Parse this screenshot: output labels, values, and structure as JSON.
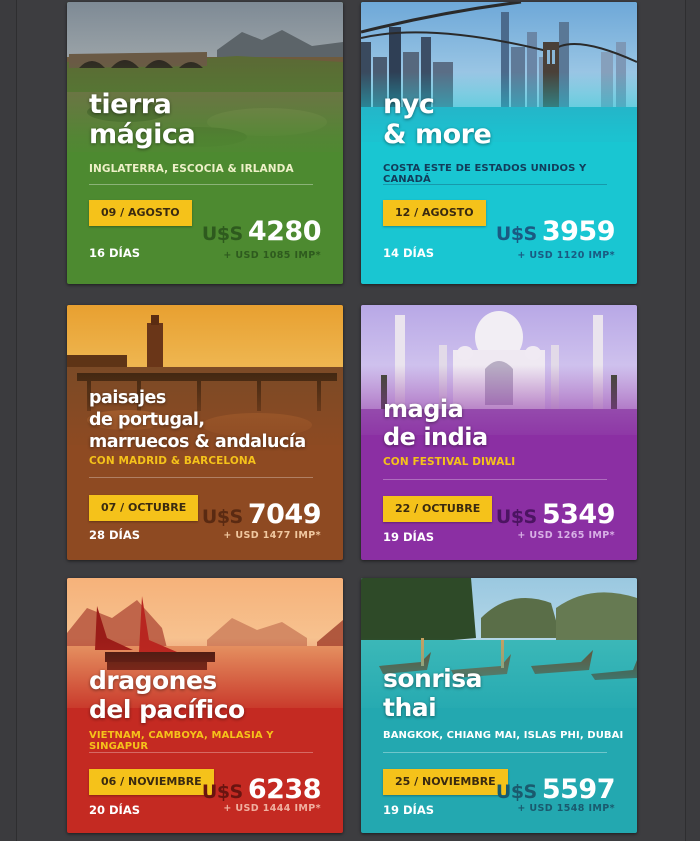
{
  "cards": [
    {
      "title_line1": "tierra",
      "title_line2": "mágica",
      "title_line3": "",
      "subtitle": "INGLATERRA, ESCOCIA & IRLANDA",
      "date": "09 / AGOSTO",
      "days": "16 DÍAS",
      "currency": "U$S",
      "price": "4280",
      "taxes": "+ USD 1085 IMP*",
      "color": "#4d8a30"
    },
    {
      "title_line1": "nyc",
      "title_line2": "& more",
      "title_line3": "",
      "subtitle": "COSTA ESTE DE ESTADOS UNIDOS Y CANADÁ",
      "date": "12 / AGOSTO",
      "days": "14 DÍAS",
      "currency": "U$S",
      "price": "3959",
      "taxes": "+ USD 1120 IMP*",
      "color": "#19c6d2"
    },
    {
      "title_line1": "paisajes",
      "title_line2": "de portugal,",
      "title_line3": "marruecos & andalucía",
      "subtitle": "CON MADRID & BARCELONA",
      "date": "07 / OCTUBRE",
      "days": "28 DÍAS",
      "currency": "U$S",
      "price": "7049",
      "taxes": "+ USD 1477 IMP*",
      "color": "#8e4a22"
    },
    {
      "title_line1": "magia",
      "title_line2": "de india",
      "title_line3": "",
      "subtitle": "CON FESTIVAL DIWALI",
      "date": "22 / OCTUBRE",
      "days": "19 DÍAS",
      "currency": "U$S",
      "price": "5349",
      "taxes": "+ USD 1265 IMP*",
      "color": "#8b2fa3"
    },
    {
      "title_line1": "dragones",
      "title_line2": "del pacífico",
      "title_line3": "",
      "subtitle": "VIETNAM, CAMBOYA, MALASIA Y SINGAPUR",
      "date": "06 / NOVIEMBRE",
      "days": "20 DÍAS",
      "currency": "U$S",
      "price": "6238",
      "taxes": "+ USD 1444 IMP*",
      "color": "#c42a22"
    },
    {
      "title_line1": "sonrisa",
      "title_line2": "thai",
      "title_line3": "",
      "subtitle": "BANGKOK, CHIANG MAI, ISLAS PHI, DUBAI",
      "date": "25 / NOVIEMBRE",
      "days": "19 DÍAS",
      "currency": "U$S",
      "price": "5597",
      "taxes": "+ USD 1548 IMP*",
      "color": "#23a8b0"
    }
  ]
}
